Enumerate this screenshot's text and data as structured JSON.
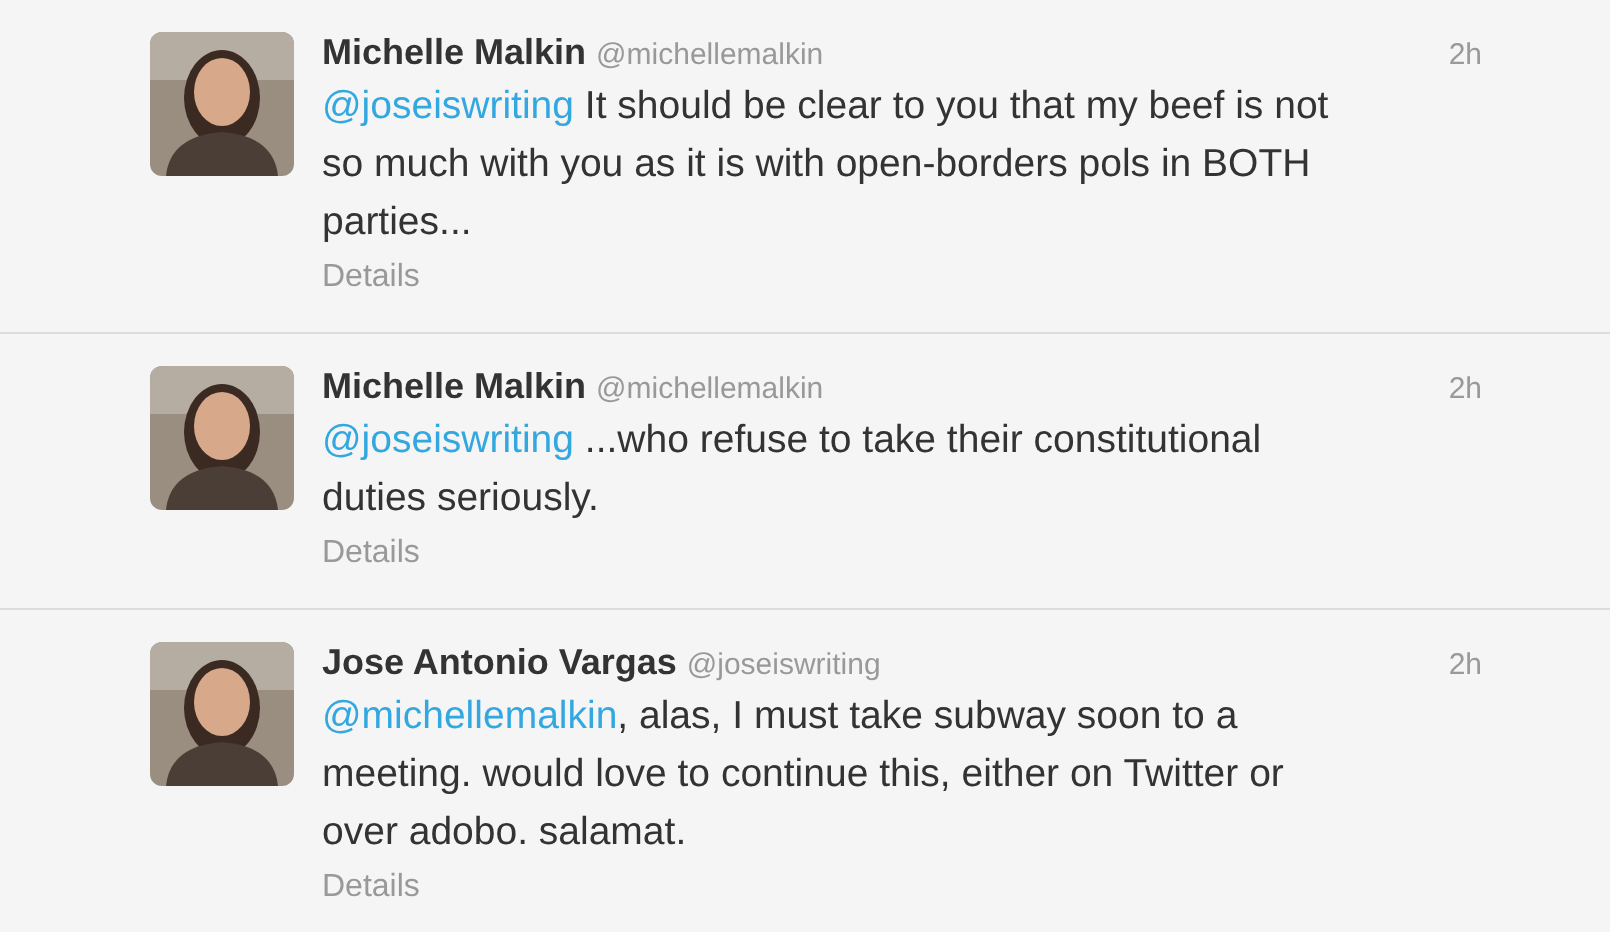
{
  "tweets": [
    {
      "name": "Michelle Malkin",
      "handle": "@michellemalkin",
      "time": "2h",
      "mention": "@joseiswriting",
      "text": " It should be clear to you that my beef is not so much with you as it is with open-borders pols in BOTH parties...",
      "details": "Details"
    },
    {
      "name": "Michelle Malkin",
      "handle": "@michellemalkin",
      "time": "2h",
      "mention": "@joseiswriting",
      "text": " ...who refuse to take their constitutional duties seriously.",
      "details": "Details"
    },
    {
      "name": "Jose Antonio Vargas",
      "handle": "@joseiswriting",
      "time": "2h",
      "mention": "@michellemalkin",
      "text": ", alas, I must take subway soon to a meeting. would love to continue this, either on Twitter or over adobo. salamat.",
      "details": "Details"
    }
  ]
}
